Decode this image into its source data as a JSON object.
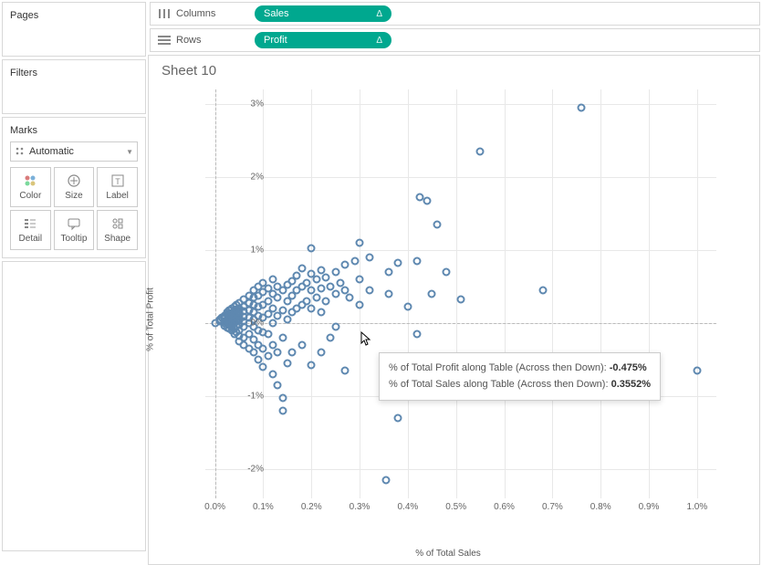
{
  "sidebar": {
    "pages_label": "Pages",
    "filters_label": "Filters",
    "marks_label": "Marks",
    "marks_type": "Automatic",
    "mark_buttons": [
      {
        "label": "Color",
        "icon": "color"
      },
      {
        "label": "Size",
        "icon": "size"
      },
      {
        "label": "Label",
        "icon": "label"
      },
      {
        "label": "Detail",
        "icon": "detail"
      },
      {
        "label": "Tooltip",
        "icon": "tooltip"
      },
      {
        "label": "Shape",
        "icon": "shape"
      }
    ]
  },
  "shelves": {
    "columns_label": "Columns",
    "rows_label": "Rows",
    "columns_pill": "Sales",
    "rows_pill": "Profit",
    "delta": "Δ"
  },
  "sheet": {
    "title": "Sheet 10",
    "y_axis_title": "% of Total Profit",
    "x_axis_title": "% of Total Sales"
  },
  "tooltip": {
    "line1_label": "% of Total Profit along Table (Across then Down):",
    "line1_value": "-0.475%",
    "line2_label": "% of Total Sales along Table (Across then Down):",
    "line2_value": "0.3552%"
  },
  "chart_data": {
    "type": "scatter",
    "xlabel": "% of Total Sales",
    "ylabel": "% of Total Profit",
    "xlim": [
      -0.02,
      1.04
    ],
    "ylim": [
      -2.4,
      3.2
    ],
    "x_ticks": [
      0.0,
      0.1,
      0.2,
      0.3,
      0.4,
      0.5,
      0.6,
      0.7,
      0.8,
      0.9,
      1.0
    ],
    "x_tick_labels": [
      "0.0%",
      "0.1%",
      "0.2%",
      "0.3%",
      "0.4%",
      "0.5%",
      "0.6%",
      "0.7%",
      "0.8%",
      "0.9%",
      "1.0%"
    ],
    "y_ticks": [
      -2,
      -1,
      0,
      1,
      2,
      3
    ],
    "y_tick_labels": [
      "-2%",
      "-1%",
      "0%",
      "1%",
      "2%",
      "3%"
    ],
    "points": [
      [
        0.0,
        0.0
      ],
      [
        0.01,
        0.02
      ],
      [
        0.01,
        0.05
      ],
      [
        0.015,
        0.07
      ],
      [
        0.02,
        -0.04
      ],
      [
        0.02,
        0.0
      ],
      [
        0.02,
        0.03
      ],
      [
        0.02,
        0.06
      ],
      [
        0.02,
        0.1
      ],
      [
        0.025,
        -0.06
      ],
      [
        0.025,
        0.02
      ],
      [
        0.025,
        0.12
      ],
      [
        0.025,
        0.15
      ],
      [
        0.03,
        -0.08
      ],
      [
        0.03,
        -0.03
      ],
      [
        0.03,
        0.0
      ],
      [
        0.03,
        0.04
      ],
      [
        0.03,
        0.08
      ],
      [
        0.03,
        0.11
      ],
      [
        0.03,
        0.18
      ],
      [
        0.035,
        -0.1
      ],
      [
        0.035,
        -0.05
      ],
      [
        0.035,
        0.02
      ],
      [
        0.035,
        0.06
      ],
      [
        0.035,
        0.1
      ],
      [
        0.035,
        0.14
      ],
      [
        0.035,
        0.2
      ],
      [
        0.04,
        -0.15
      ],
      [
        0.04,
        -0.07
      ],
      [
        0.04,
        0.0
      ],
      [
        0.04,
        0.05
      ],
      [
        0.04,
        0.09
      ],
      [
        0.04,
        0.13
      ],
      [
        0.04,
        0.17
      ],
      [
        0.04,
        0.22
      ],
      [
        0.045,
        -0.12
      ],
      [
        0.045,
        -0.04
      ],
      [
        0.045,
        0.03
      ],
      [
        0.045,
        0.08
      ],
      [
        0.045,
        0.12
      ],
      [
        0.045,
        0.19
      ],
      [
        0.045,
        0.25
      ],
      [
        0.05,
        -0.25
      ],
      [
        0.05,
        -0.18
      ],
      [
        0.05,
        -0.1
      ],
      [
        0.05,
        -0.02
      ],
      [
        0.05,
        0.04
      ],
      [
        0.05,
        0.1
      ],
      [
        0.05,
        0.15
      ],
      [
        0.05,
        0.2
      ],
      [
        0.05,
        0.28
      ],
      [
        0.06,
        -0.3
      ],
      [
        0.06,
        -0.2
      ],
      [
        0.06,
        -0.05
      ],
      [
        0.06,
        0.02
      ],
      [
        0.06,
        0.09
      ],
      [
        0.06,
        0.16
      ],
      [
        0.06,
        0.23
      ],
      [
        0.06,
        0.32
      ],
      [
        0.07,
        -0.35
      ],
      [
        0.07,
        -0.15
      ],
      [
        0.07,
        0.0
      ],
      [
        0.07,
        0.08
      ],
      [
        0.07,
        0.18
      ],
      [
        0.07,
        0.27
      ],
      [
        0.07,
        0.38
      ],
      [
        0.08,
        -0.4
      ],
      [
        0.08,
        -0.22
      ],
      [
        0.08,
        -0.05
      ],
      [
        0.08,
        0.05
      ],
      [
        0.08,
        0.15
      ],
      [
        0.08,
        0.25
      ],
      [
        0.08,
        0.35
      ],
      [
        0.08,
        0.45
      ],
      [
        0.09,
        -0.5
      ],
      [
        0.09,
        -0.3
      ],
      [
        0.09,
        -0.1
      ],
      [
        0.09,
        0.1
      ],
      [
        0.09,
        0.22
      ],
      [
        0.09,
        0.38
      ],
      [
        0.09,
        0.5
      ],
      [
        0.1,
        -0.6
      ],
      [
        0.1,
        -0.35
      ],
      [
        0.1,
        -0.12
      ],
      [
        0.1,
        0.08
      ],
      [
        0.1,
        0.25
      ],
      [
        0.1,
        0.42
      ],
      [
        0.1,
        0.55
      ],
      [
        0.11,
        -0.45
      ],
      [
        0.11,
        -0.15
      ],
      [
        0.11,
        0.12
      ],
      [
        0.11,
        0.3
      ],
      [
        0.11,
        0.48
      ],
      [
        0.12,
        -0.7
      ],
      [
        0.12,
        -0.3
      ],
      [
        0.12,
        0.0
      ],
      [
        0.12,
        0.2
      ],
      [
        0.12,
        0.4
      ],
      [
        0.12,
        0.6
      ],
      [
        0.13,
        -0.85
      ],
      [
        0.13,
        -0.4
      ],
      [
        0.13,
        0.1
      ],
      [
        0.13,
        0.35
      ],
      [
        0.13,
        0.5
      ],
      [
        0.14,
        -1.02
      ],
      [
        0.14,
        -1.2
      ],
      [
        0.14,
        -0.2
      ],
      [
        0.14,
        0.18
      ],
      [
        0.14,
        0.45
      ],
      [
        0.15,
        -0.55
      ],
      [
        0.15,
        0.05
      ],
      [
        0.15,
        0.3
      ],
      [
        0.15,
        0.52
      ],
      [
        0.16,
        -0.4
      ],
      [
        0.16,
        0.15
      ],
      [
        0.16,
        0.38
      ],
      [
        0.16,
        0.58
      ],
      [
        0.17,
        0.2
      ],
      [
        0.17,
        0.45
      ],
      [
        0.17,
        0.65
      ],
      [
        0.18,
        -0.3
      ],
      [
        0.18,
        0.25
      ],
      [
        0.18,
        0.5
      ],
      [
        0.18,
        0.75
      ],
      [
        0.19,
        0.3
      ],
      [
        0.19,
        0.55
      ],
      [
        0.2,
        -0.58
      ],
      [
        0.2,
        0.2
      ],
      [
        0.2,
        0.45
      ],
      [
        0.2,
        0.68
      ],
      [
        0.2,
        1.02
      ],
      [
        0.21,
        0.35
      ],
      [
        0.21,
        0.6
      ],
      [
        0.22,
        -0.4
      ],
      [
        0.22,
        0.15
      ],
      [
        0.22,
        0.48
      ],
      [
        0.22,
        0.72
      ],
      [
        0.23,
        0.3
      ],
      [
        0.23,
        0.62
      ],
      [
        0.24,
        -0.2
      ],
      [
        0.24,
        0.5
      ],
      [
        0.25,
        -0.05
      ],
      [
        0.25,
        0.4
      ],
      [
        0.25,
        0.7
      ],
      [
        0.26,
        0.55
      ],
      [
        0.27,
        -0.65
      ],
      [
        0.27,
        0.45
      ],
      [
        0.27,
        0.8
      ],
      [
        0.28,
        0.35
      ],
      [
        0.29,
        0.85
      ],
      [
        0.3,
        0.25
      ],
      [
        0.3,
        0.6
      ],
      [
        0.3,
        1.1
      ],
      [
        0.32,
        0.45
      ],
      [
        0.32,
        0.9
      ],
      [
        0.355,
        -2.15
      ],
      [
        0.355,
        -0.475
      ],
      [
        0.36,
        0.4
      ],
      [
        0.36,
        0.7
      ],
      [
        0.38,
        -1.3
      ],
      [
        0.38,
        0.82
      ],
      [
        0.4,
        0.22
      ],
      [
        0.42,
        -0.15
      ],
      [
        0.42,
        0.85
      ],
      [
        0.425,
        1.72
      ],
      [
        0.44,
        1.68
      ],
      [
        0.45,
        0.4
      ],
      [
        0.46,
        1.35
      ],
      [
        0.48,
        0.7
      ],
      [
        0.51,
        0.32
      ],
      [
        0.55,
        2.35
      ],
      [
        0.68,
        0.45
      ],
      [
        0.76,
        2.95
      ],
      [
        1.0,
        -0.65
      ]
    ]
  }
}
